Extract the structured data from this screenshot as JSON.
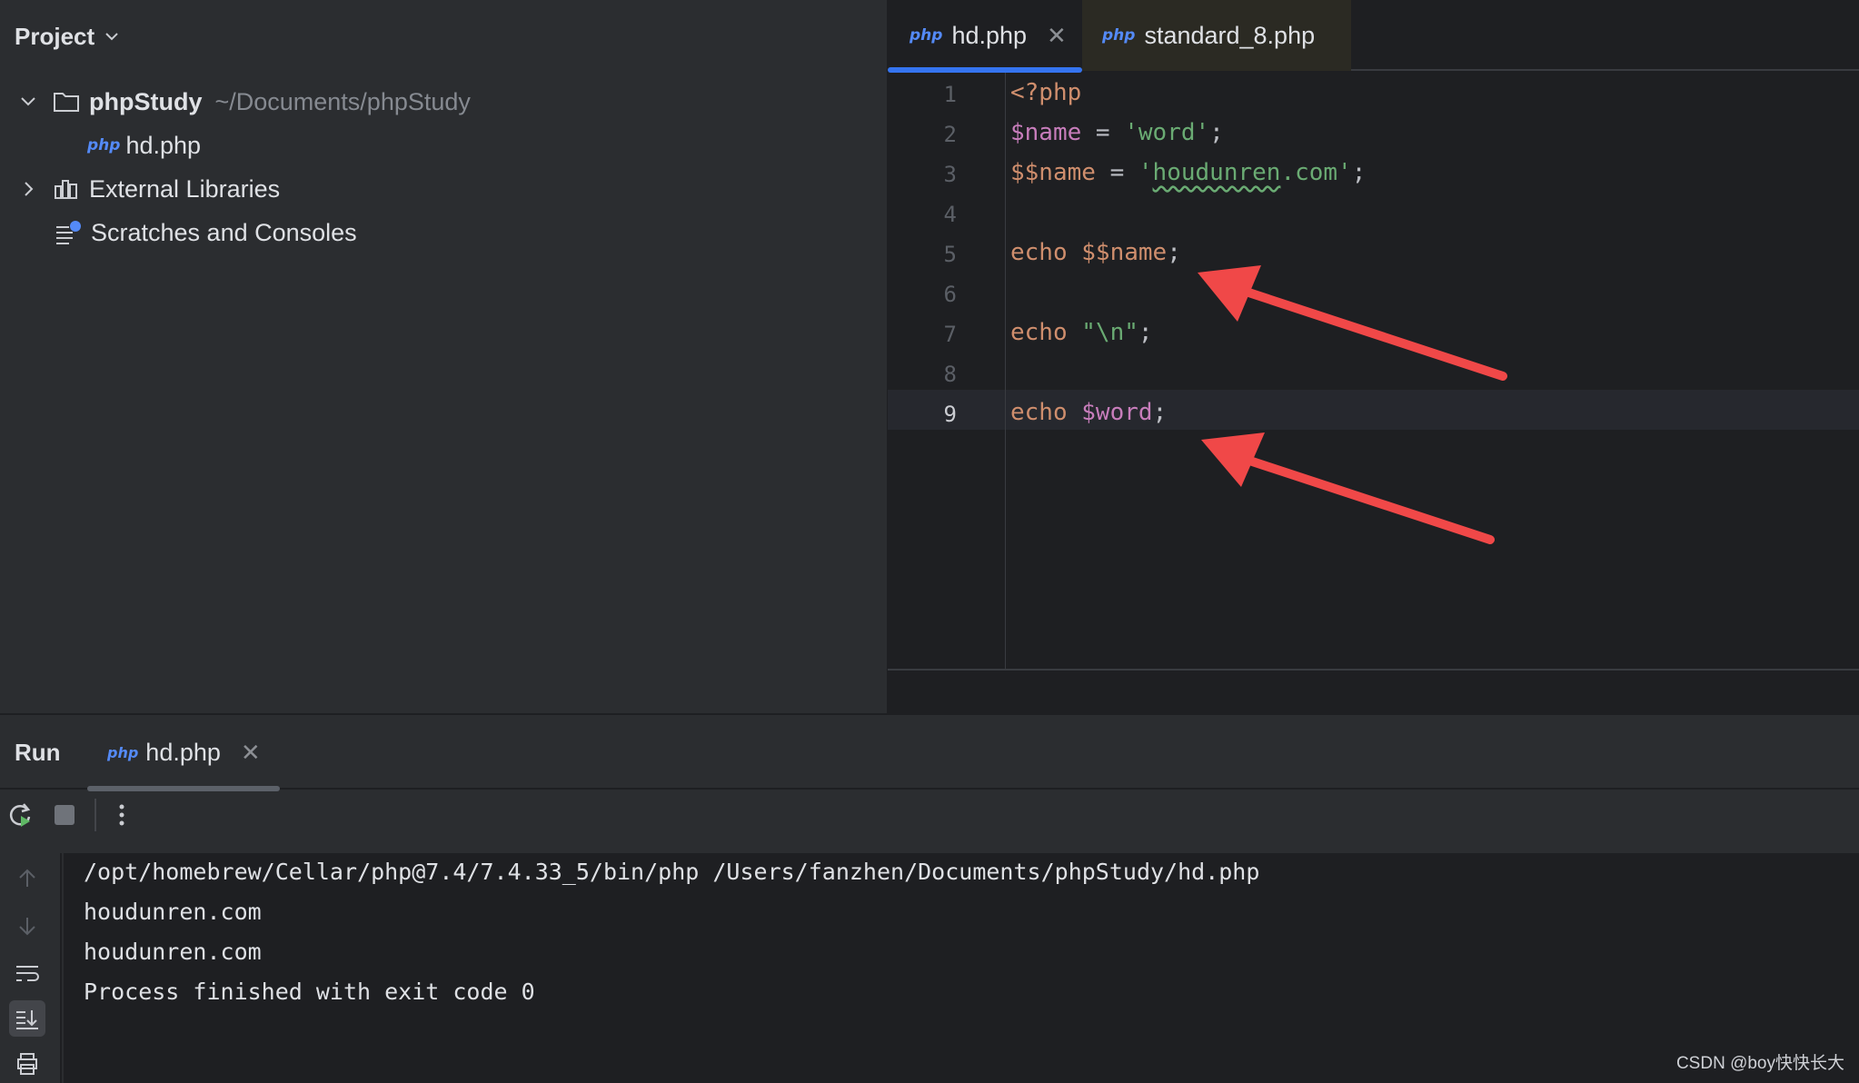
{
  "project": {
    "title": "Project",
    "tree": [
      {
        "label": "phpStudy",
        "path": "~/Documents/phpStudy",
        "icon": "folder-icon"
      },
      {
        "label": "hd.php",
        "badge": "php",
        "icon": "php-file-icon"
      },
      {
        "label": "External Libraries",
        "icon": "library-icon"
      },
      {
        "label": "Scratches and Consoles",
        "icon": "scratches-icon"
      }
    ]
  },
  "editor": {
    "tabs": [
      {
        "label": "hd.php",
        "badge": "php",
        "active": true
      },
      {
        "label": "standard_8.php",
        "badge": "php",
        "active": false
      }
    ],
    "line_numbers": [
      "1",
      "2",
      "3",
      "4",
      "5",
      "6",
      "7",
      "8",
      "9"
    ],
    "current_line": 9,
    "code": {
      "l1": "<?php",
      "l2_var": "$name",
      "l2_eq": " = ",
      "l2_str": "'word'",
      "l2_end": ";",
      "l3_var": "$$name",
      "l3_eq": " = ",
      "l3_q1": "'",
      "l3_str": "houdunren",
      "l3_rest": ".com'",
      "l3_end": ";",
      "l5_kw": "echo ",
      "l5_var": "$$name",
      "l5_end": ";",
      "l7_kw": "echo ",
      "l7_str": "\"\\n\"",
      "l7_end": ";",
      "l9_kw": "echo ",
      "l9_var": "$word",
      "l9_end": ";"
    }
  },
  "annotations": {
    "arrow_color": "#f04848"
  },
  "run": {
    "title": "Run",
    "tab_label": "hd.php",
    "tab_badge": "php",
    "console": [
      "/opt/homebrew/Cellar/php@7.4/7.4.33_5/bin/php /Users/fanzhen/Documents/phpStudy/hd.php",
      "houdunren.com",
      "houdunren.com",
      "Process finished with exit code 0"
    ]
  },
  "watermark": "CSDN @boy快快长大",
  "colors": {
    "accent": "#3574f0",
    "keyword": "#cf8e6d",
    "variable": "#c77dbb",
    "string": "#6aab73"
  }
}
